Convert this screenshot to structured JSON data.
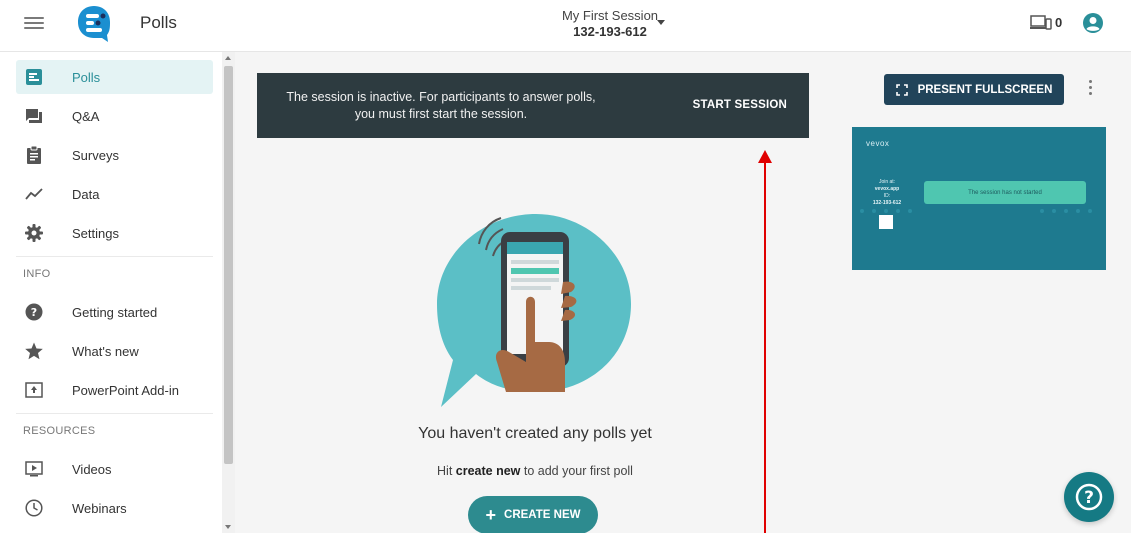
{
  "app": {
    "title": "Polls"
  },
  "session": {
    "name": "My First Session",
    "id": "132-193-612"
  },
  "devices": {
    "count": "0"
  },
  "sidebar": {
    "items": [
      {
        "label": "Polls",
        "icon": "polls-icon",
        "active": true
      },
      {
        "label": "Q&A",
        "icon": "qa-icon"
      },
      {
        "label": "Surveys",
        "icon": "surveys-icon"
      },
      {
        "label": "Data",
        "icon": "data-icon"
      },
      {
        "label": "Settings",
        "icon": "gear-icon"
      }
    ],
    "info_heading": "INFO",
    "info_items": [
      {
        "label": "Getting started",
        "icon": "help-circle-icon"
      },
      {
        "label": "What's new",
        "icon": "star-icon"
      },
      {
        "label": "PowerPoint Add-in",
        "icon": "upload-icon"
      }
    ],
    "resources_heading": "RESOURCES",
    "resources_items": [
      {
        "label": "Videos",
        "icon": "video-icon"
      },
      {
        "label": "Webinars",
        "icon": "clock-icon"
      }
    ]
  },
  "banner": {
    "message": "The session is inactive. For participants to answer polls, you must first start the session.",
    "action": "START SESSION"
  },
  "empty": {
    "title": "You haven't created any polls yet",
    "hint_prefix": "Hit ",
    "hint_bold": "create new",
    "hint_suffix": " to add your first poll",
    "button": "CREATE NEW"
  },
  "present": {
    "label": "PRESENT FULLSCREEN"
  },
  "preview": {
    "logo": "vevox",
    "join_label": "Join at:",
    "join_url": "vevox.app",
    "id_label": "ID:",
    "id_value": "132-193-612",
    "message": "The session has not started"
  },
  "colors": {
    "accent": "#2d8b8f",
    "banner_bg": "#2d3b40",
    "present_bg": "#21445a",
    "preview_bg": "#1e7a8f",
    "annotation_arrow": "#e00000"
  }
}
